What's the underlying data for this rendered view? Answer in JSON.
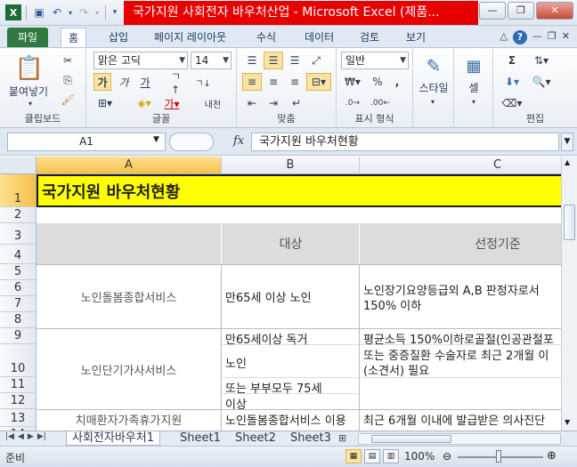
{
  "window": {
    "title": "국가지원 사회전자 바우처산업 - Microsoft Excel (제품...",
    "quick_access": [
      "save-icon",
      "undo-icon",
      "redo-icon"
    ],
    "controls": [
      "minimize",
      "maximize",
      "close"
    ]
  },
  "ribbon_tabs": [
    "파일",
    "홈",
    "삽입",
    "페이지 레이아웃",
    "수식",
    "데이터",
    "검토",
    "보기"
  ],
  "ribbon": {
    "clipboard": {
      "paste": "붙여넣기",
      "label": "클립보드"
    },
    "font": {
      "name": "맑은 고딕",
      "size": "14",
      "bold": "가",
      "italic": "가",
      "underline": "가",
      "label": "글꼴",
      "wrap": "내천"
    },
    "alignment": {
      "label": "맞춤"
    },
    "number": {
      "format": "일반",
      "percent": "%",
      "comma": ",",
      "label": "표시 형식"
    },
    "styles": {
      "label": "스타일"
    },
    "cells": {
      "label": "셀"
    },
    "editing": {
      "label": "편집",
      "sum": "Σ"
    }
  },
  "formula_bar": {
    "name_box": "A1",
    "fx": "fx",
    "content": "국가지원 바우처현황"
  },
  "columns": [
    "A",
    "B",
    "C"
  ],
  "rows": [
    "1",
    "2",
    "3",
    "4",
    "5",
    "6",
    "7",
    "8",
    "9",
    "10",
    "11",
    "12",
    "13",
    "14"
  ],
  "cells": {
    "a1": "국가지원 바우처현황",
    "b_header": "대상",
    "c_header": "선정기준",
    "a_row5_8": "노인돌봄종합서비스",
    "b_row5_8": "만65세 이상 노인",
    "c_row6_line1": "노인장기요양등급외 A,B  판정자로서",
    "c_row6_line2": "150% 이하",
    "b9": "만65세이상 독거",
    "c9": "평균소득 150%이하로골절(인공관절포",
    "a_row9_12": "노인단기가사서비스",
    "b10": "노인",
    "c10_line1": "또는 중증질환 수술자로 최근 2개월 이",
    "c10_line2": "(소견서) 필요",
    "b11": "또는 부부모두 75세",
    "b12": "이상",
    "a13": "치매환자가족휴가지원",
    "b13": "노인돌봄종합서비스 이용",
    "c13": "최근 6개월 이내에 발급받은 의사진단"
  },
  "sheets": [
    "사회전자바우처1",
    "Sheet1",
    "Sheet2",
    "Sheet3"
  ],
  "status": {
    "text": "준비",
    "zoom": "100%",
    "zoom_fraction": 0.5
  },
  "colors": {
    "title_bg": "#e60000",
    "header_row_bg": "#ffff00",
    "file_tab": "#2f7b3f"
  }
}
